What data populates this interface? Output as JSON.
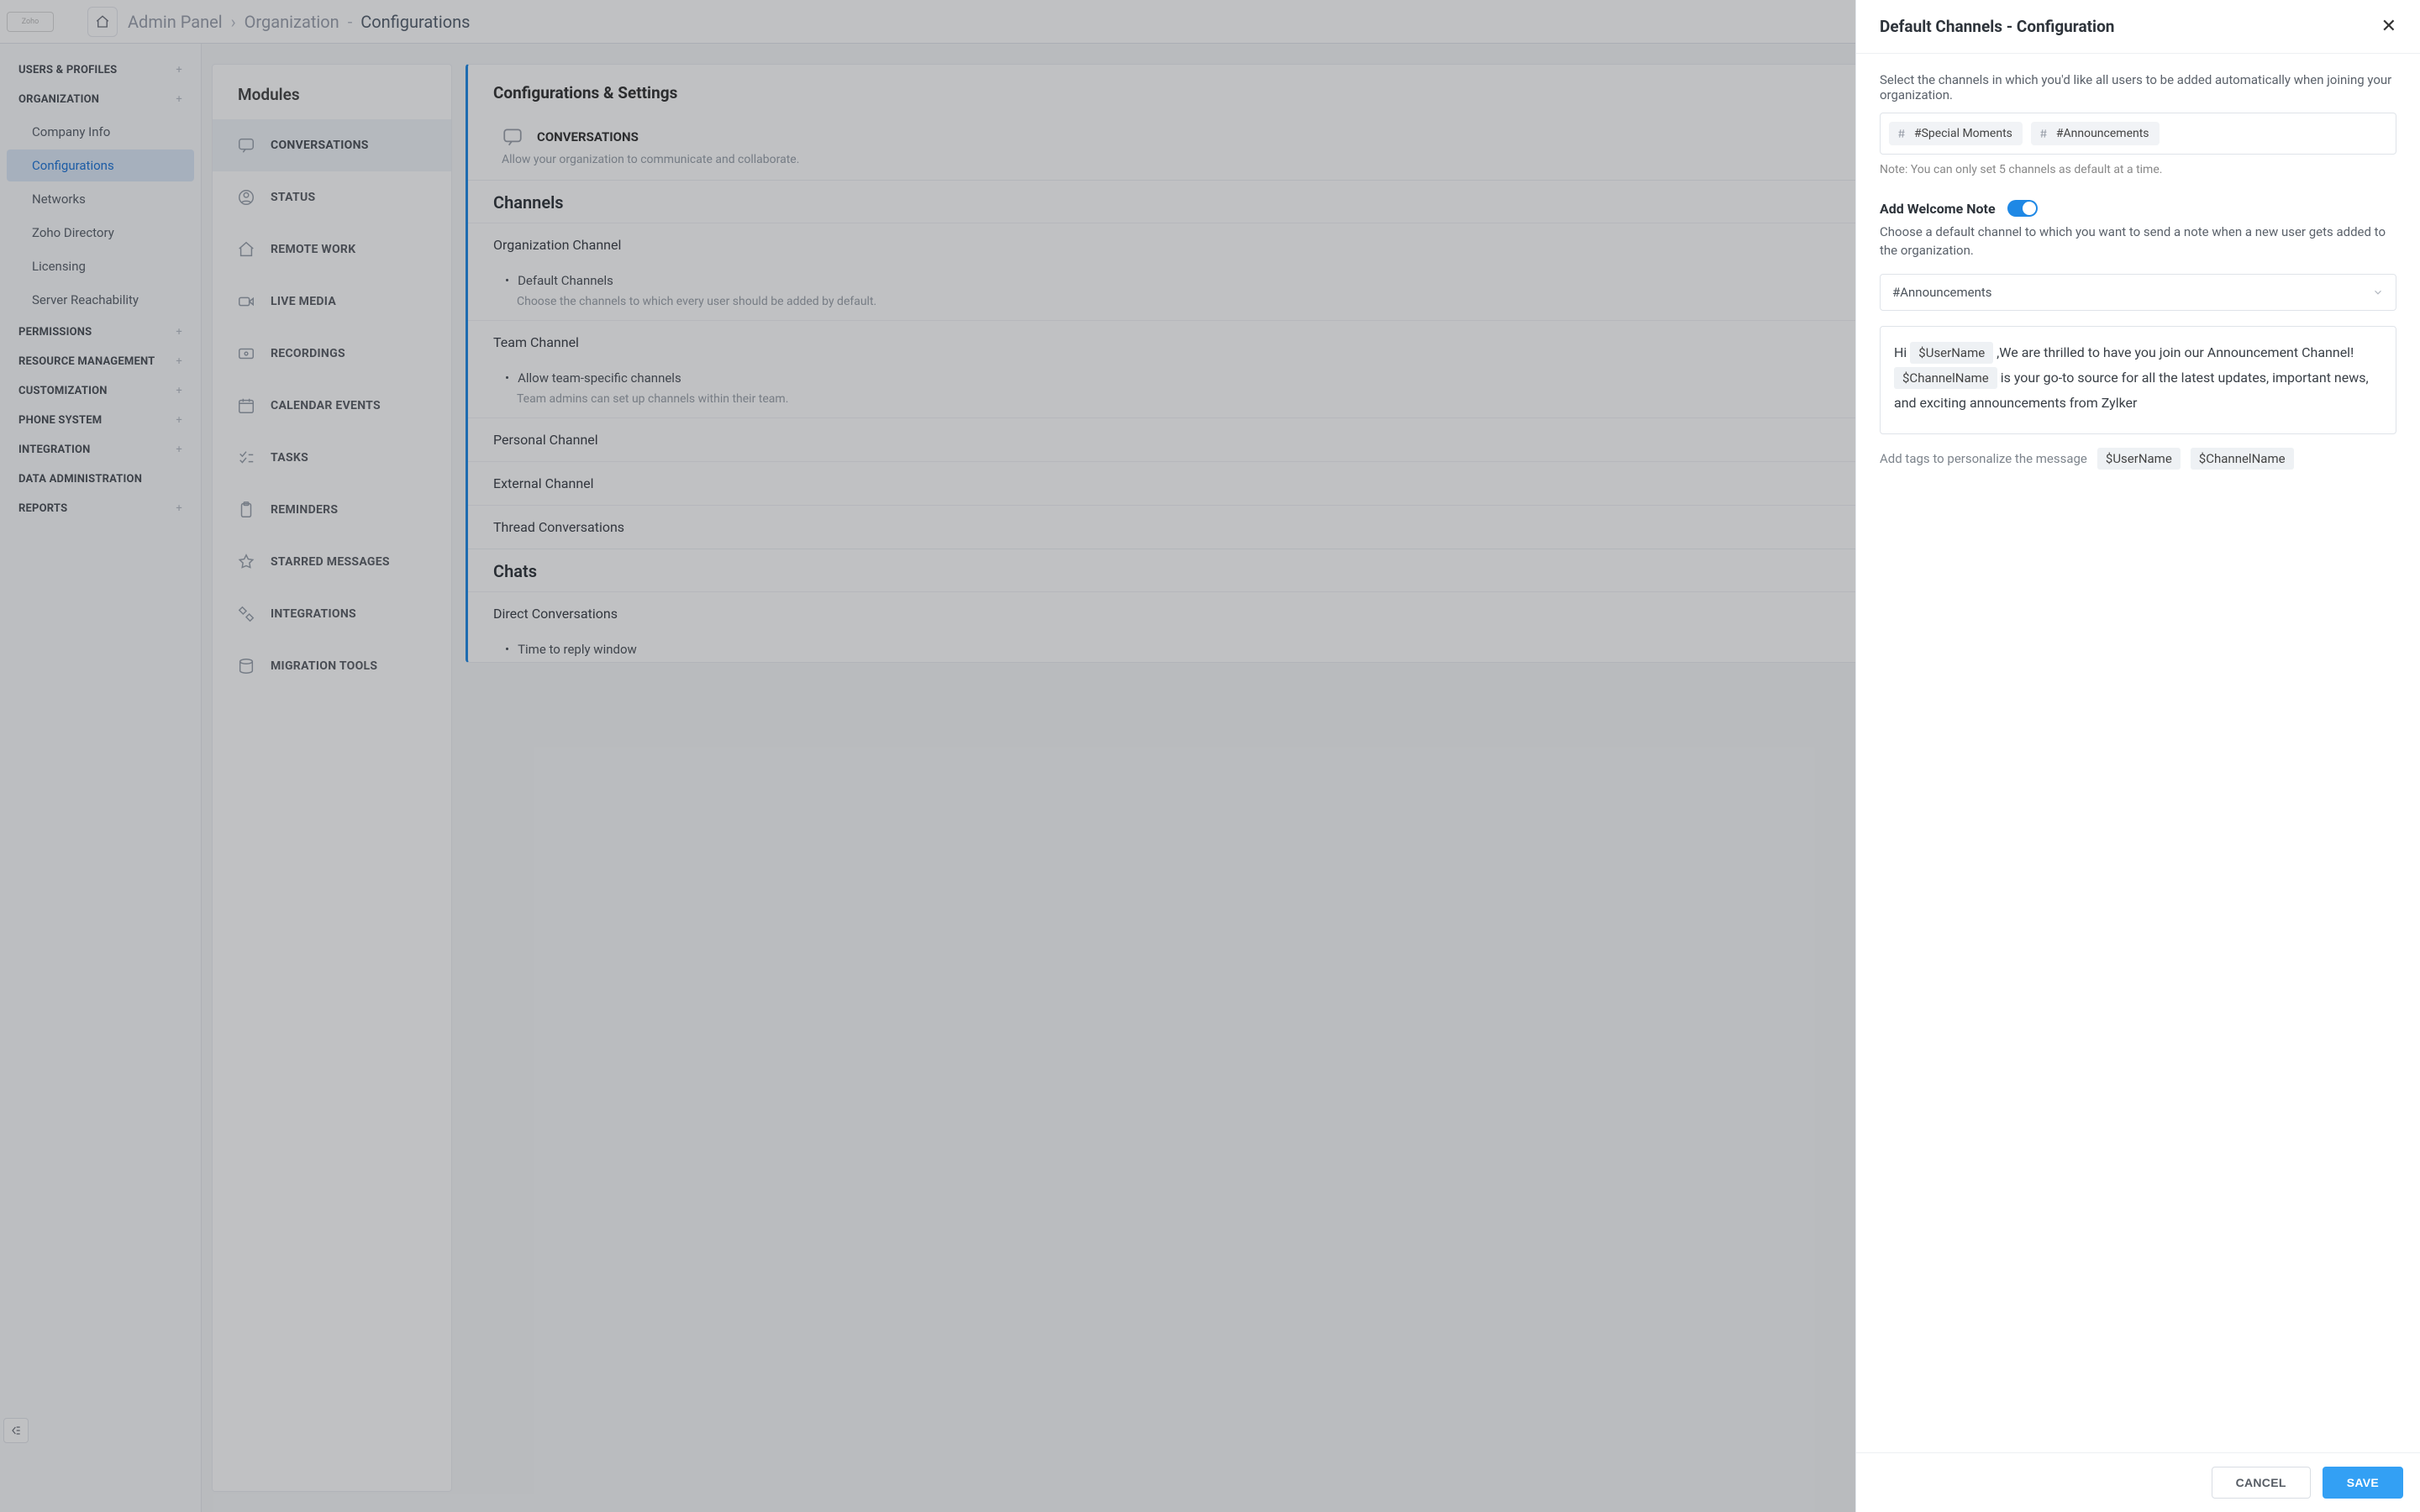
{
  "topbar": {
    "brand": "Zoho",
    "crumbs": [
      "Admin Panel",
      "Organization",
      "Configurations"
    ]
  },
  "leftrail": {
    "groups": [
      {
        "label": "USERS & PROFILES",
        "plus": true,
        "items": []
      },
      {
        "label": "ORGANIZATION",
        "plus": true,
        "items": [
          "Company Info",
          "Configurations",
          "Networks",
          "Zoho Directory",
          "Licensing",
          "Server Reachability"
        ],
        "active": "Configurations"
      },
      {
        "label": "PERMISSIONS",
        "plus": true
      },
      {
        "label": "RESOURCE MANAGEMENT",
        "plus": true
      },
      {
        "label": "CUSTOMIZATION",
        "plus": true
      },
      {
        "label": "PHONE SYSTEM",
        "plus": true
      },
      {
        "label": "INTEGRATION",
        "plus": true
      },
      {
        "label": "DATA ADMINISTRATION"
      },
      {
        "label": "REPORTS",
        "plus": true
      }
    ]
  },
  "modules": {
    "title": "Modules",
    "items": [
      "CONVERSATIONS",
      "STATUS",
      "REMOTE WORK",
      "LIVE MEDIA",
      "RECORDINGS",
      "CALENDAR EVENTS",
      "TASKS",
      "REMINDERS",
      "STARRED MESSAGES",
      "INTEGRATIONS",
      "MIGRATION TOOLS"
    ],
    "active": "CONVERSATIONS"
  },
  "main": {
    "heading": "Configurations & Settings",
    "module_block": {
      "title": "CONVERSATIONS",
      "sub": "Allow your organization to communicate and collaborate."
    },
    "section_channels": "Channels",
    "rows": {
      "org_channel": "Organization Channel",
      "default_channels_bullet": "Default Channels",
      "default_channels_hint": "Choose the channels to which every user should be added by default.",
      "team_channel": "Team Channel",
      "team_allow_bullet": "Allow team-specific channels",
      "team_allow_hint": "Team admins can set up channels within their team.",
      "personal_channel": "Personal Channel",
      "external_channel": "External Channel",
      "thread_conv": "Thread Conversations"
    },
    "section_chats": "Chats",
    "rows2": {
      "direct_conv": "Direct Conversations",
      "time_to_reply_bullet": "Time to reply window"
    }
  },
  "panel": {
    "title": "Default Channels - Configuration",
    "intro": "Select the channels in which you'd like all users to be added automatically when joining your organization.",
    "chips": [
      "#Special Moments",
      "#Announcements"
    ],
    "note": "Note: You can only set 5 channels as default at a time.",
    "welcome": {
      "label": "Add Welcome Note",
      "on": true,
      "sub": "Choose a default channel to which you want to send a note when a new user gets added to the organization.",
      "selected": "#Announcements"
    },
    "editor": {
      "pre": "Hi ",
      "tok1": "$UserName",
      "mid1": " ,We are thrilled to have you join our Announcement Channel! ",
      "tok2": "$ChannelName",
      "mid2": "  is your go-to source for all the latest updates, important news, and exciting announcements from Zylker"
    },
    "tags": {
      "label": "Add tags to personalize the message",
      "items": [
        "$UserName",
        "$ChannelName"
      ]
    },
    "buttons": {
      "cancel": "CANCEL",
      "save": "SAVE"
    }
  }
}
